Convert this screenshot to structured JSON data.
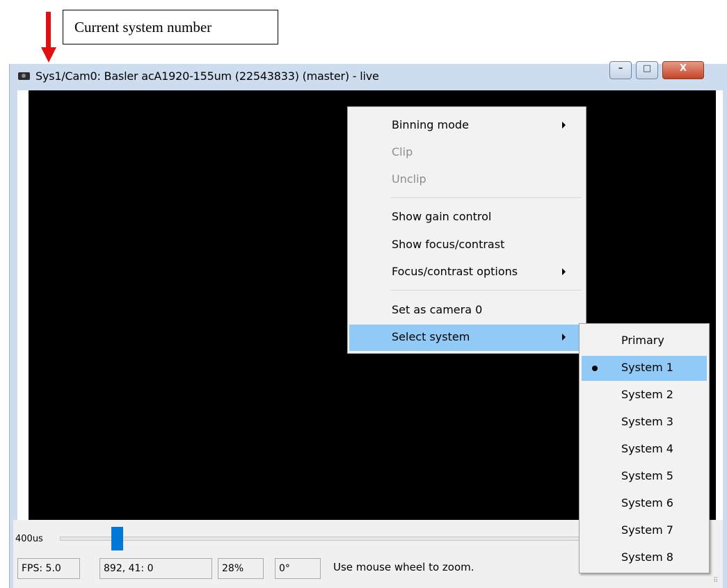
{
  "annotation": {
    "label": "Current system number",
    "arrow_color": "#e01010"
  },
  "window": {
    "title": "Sys1/Cam0: Basler acA1920-155um (22543833) (master) - live",
    "icon": "camera-icon",
    "caption_buttons": [
      {
        "name": "minimize",
        "glyph": "–"
      },
      {
        "name": "maximize",
        "glyph": "□"
      },
      {
        "name": "close",
        "glyph": "X"
      }
    ]
  },
  "bottom_panel": {
    "exposure_label": "400us",
    "exposure_slider_level": 0.11,
    "status": {
      "fps": "FPS: 5.0",
      "coords": "892, 41: 0",
      "zoom": "28%",
      "rotation": "0°",
      "message": "Use mouse wheel to zoom."
    }
  },
  "context_menu": {
    "items": [
      {
        "label": "Binning mode",
        "enabled": true,
        "submenu": true
      },
      {
        "label": "Clip",
        "enabled": false,
        "submenu": false
      },
      {
        "label": "Unclip",
        "enabled": false,
        "submenu": false
      },
      {
        "label": "Show gain control",
        "enabled": true,
        "submenu": false
      },
      {
        "label": "Show focus/contrast",
        "enabled": true,
        "submenu": false
      },
      {
        "label": "Focus/contrast options",
        "enabled": true,
        "submenu": true
      },
      {
        "label": "Set as camera 0",
        "enabled": true,
        "submenu": false
      },
      {
        "label": "Select system",
        "enabled": true,
        "submenu": true,
        "highlighted": true
      }
    ]
  },
  "system_submenu": {
    "selected": "System 1",
    "items": [
      "Primary",
      "System 1",
      "System 2",
      "System 3",
      "System 4",
      "System 5",
      "System 6",
      "System 7",
      "System 8"
    ]
  },
  "colors": {
    "highlight": "#91c9f7",
    "slider_thumb": "#0078d7",
    "video_background": "#000000"
  }
}
